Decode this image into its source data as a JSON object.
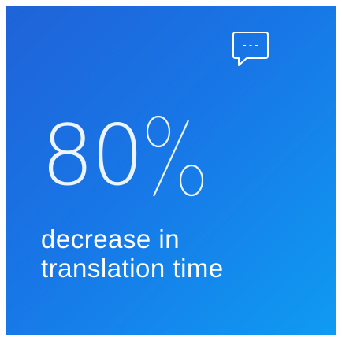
{
  "stat": {
    "value": "80",
    "unit": "%",
    "caption_line1": "decrease in",
    "caption_line2": "translation time"
  },
  "icons": {
    "top_right": "chat-bubble-icon"
  },
  "colors": {
    "gradient_start": "#1f63d8",
    "gradient_end": "#0f9bf3",
    "text": "#ffffff"
  }
}
